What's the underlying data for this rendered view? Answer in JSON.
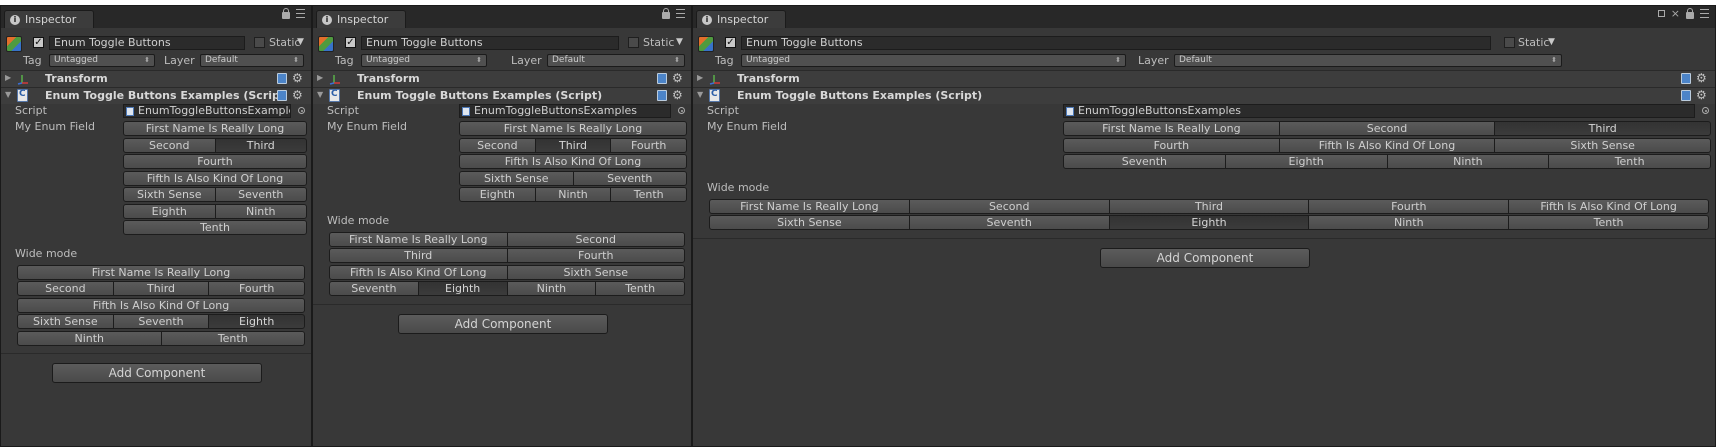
{
  "tab_title": "Inspector",
  "info_glyph": "i",
  "object_name": "Enum Toggle Buttons",
  "active_checked": true,
  "static_label": "Static",
  "tag_label": "Tag",
  "tag_value": "Untagged",
  "layer_label": "Layer",
  "layer_value": "Default",
  "transform_title": "Transform",
  "component_title": "Enum Toggle Buttons Examples (Script)",
  "script_label": "Script",
  "script_value": "EnumToggleButtonsExamples",
  "field_label": "My Enum Field",
  "wide_mode_label": "Wide mode",
  "add_component_label": "Add Component",
  "panels": [
    {
      "component_title_shown": "Enum Toggle Buttons Examples (Script",
      "script_value_shown": "EnumToggleButtonsExamples",
      "field_rows": [
        [
          {
            "label": "First Name Is Really Long",
            "selected": false
          }
        ],
        [
          {
            "label": "Second",
            "selected": false
          },
          {
            "label": "Third",
            "selected": true
          }
        ],
        [
          {
            "label": "Fourth",
            "selected": false
          }
        ],
        [
          {
            "label": "Fifth Is Also Kind Of Long",
            "selected": false
          }
        ],
        [
          {
            "label": "Sixth Sense",
            "selected": false
          },
          {
            "label": "Seventh",
            "selected": false
          }
        ],
        [
          {
            "label": "Eighth",
            "selected": false
          },
          {
            "label": "Ninth",
            "selected": false
          }
        ],
        [
          {
            "label": "Tenth",
            "selected": false
          }
        ]
      ],
      "wide_rows": [
        [
          {
            "label": "First Name Is Really Long",
            "selected": false
          }
        ],
        [
          {
            "label": "Second",
            "selected": false
          },
          {
            "label": "Third",
            "selected": false
          },
          {
            "label": "Fourth",
            "selected": false
          }
        ],
        [
          {
            "label": "Fifth Is Also Kind Of Long",
            "selected": false
          }
        ],
        [
          {
            "label": "Sixth Sense",
            "selected": false
          },
          {
            "label": "Seventh",
            "selected": false
          },
          {
            "label": "Eighth",
            "selected": true
          }
        ],
        [
          {
            "label": "Ninth",
            "selected": false
          },
          {
            "label": "Tenth",
            "selected": false
          }
        ]
      ]
    },
    {
      "component_title_shown": "Enum Toggle Buttons Examples (Script)",
      "script_value_shown": "EnumToggleButtonsExamples",
      "field_rows": [
        [
          {
            "label": "First Name Is Really Long",
            "selected": false
          }
        ],
        [
          {
            "label": "Second",
            "selected": false
          },
          {
            "label": "Third",
            "selected": true
          },
          {
            "label": "Fourth",
            "selected": false
          }
        ],
        [
          {
            "label": "Fifth Is Also Kind Of Long",
            "selected": false
          }
        ],
        [
          {
            "label": "Sixth Sense",
            "selected": false
          },
          {
            "label": "Seventh",
            "selected": false
          }
        ],
        [
          {
            "label": "Eighth",
            "selected": false
          },
          {
            "label": "Ninth",
            "selected": false
          },
          {
            "label": "Tenth",
            "selected": false
          }
        ]
      ],
      "wide_rows": [
        [
          {
            "label": "First Name Is Really Long",
            "selected": false
          },
          {
            "label": "Second",
            "selected": false
          }
        ],
        [
          {
            "label": "Third",
            "selected": false
          },
          {
            "label": "Fourth",
            "selected": false
          }
        ],
        [
          {
            "label": "Fifth Is Also Kind Of Long",
            "selected": false
          },
          {
            "label": "Sixth Sense",
            "selected": false
          }
        ],
        [
          {
            "label": "Seventh",
            "selected": false
          },
          {
            "label": "Eighth",
            "selected": true
          },
          {
            "label": "Ninth",
            "selected": false
          },
          {
            "label": "Tenth",
            "selected": false
          }
        ]
      ]
    },
    {
      "component_title_shown": "Enum Toggle Buttons Examples (Script)",
      "script_value_shown": "EnumToggleButtonsExamples",
      "field_rows": [
        [
          {
            "label": "First Name Is Really Long",
            "selected": false
          },
          {
            "label": "Second",
            "selected": false
          },
          {
            "label": "Third",
            "selected": true
          }
        ],
        [
          {
            "label": "Fourth",
            "selected": false
          },
          {
            "label": "Fifth Is Also Kind Of Long",
            "selected": false
          },
          {
            "label": "Sixth Sense",
            "selected": false
          }
        ],
        [
          {
            "label": "Seventh",
            "selected": false
          },
          {
            "label": "Eighth",
            "selected": false
          },
          {
            "label": "Ninth",
            "selected": false
          },
          {
            "label": "Tenth",
            "selected": false
          }
        ]
      ],
      "wide_rows": [
        [
          {
            "label": "First Name Is Really Long",
            "selected": false
          },
          {
            "label": "Second",
            "selected": false
          },
          {
            "label": "Third",
            "selected": false
          },
          {
            "label": "Fourth",
            "selected": false
          },
          {
            "label": "Fifth Is Also Kind Of Long",
            "selected": false
          }
        ],
        [
          {
            "label": "Sixth Sense",
            "selected": false
          },
          {
            "label": "Seventh",
            "selected": false
          },
          {
            "label": "Eighth",
            "selected": true
          },
          {
            "label": "Ninth",
            "selected": false
          },
          {
            "label": "Tenth",
            "selected": false
          }
        ]
      ]
    }
  ]
}
